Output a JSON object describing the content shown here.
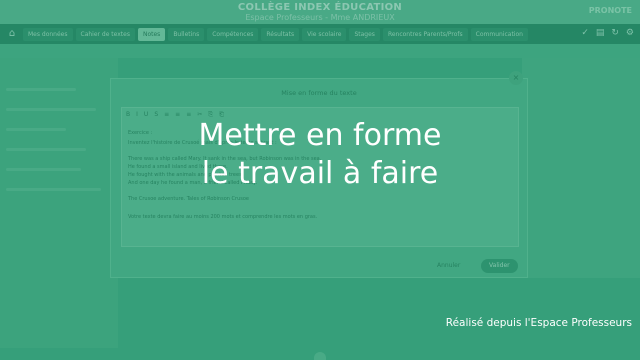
{
  "header": {
    "school_name": "COLLÈGE INDEX ÉDUCATION",
    "subtitle": "Espace Professeurs - Mme ANDRIEUX",
    "brand": "PRONOTE"
  },
  "nav": {
    "home_icon": "home-icon",
    "items": [
      {
        "label": "Mes données"
      },
      {
        "label": "Cahier de textes"
      },
      {
        "label": "Notes",
        "active": true
      },
      {
        "label": "Bulletins"
      },
      {
        "label": "Compétences"
      },
      {
        "label": "Résultats"
      },
      {
        "label": "Vie scolaire"
      },
      {
        "label": "Stages"
      },
      {
        "label": "Rencontres Parents/Profs"
      },
      {
        "label": "Communication"
      }
    ]
  },
  "dialog": {
    "title": "Mise en forme du texte",
    "toolbar": [
      "B",
      "I",
      "U",
      "S",
      "≡",
      "≡",
      "≡",
      "✂",
      "⎘",
      "⎗"
    ],
    "lines": [
      "Exercice :",
      "Inventez l'histoire de Crusoé mais d'après le texte suivant :",
      "There was a ship called Mary. It sank in the sea, but Robinson was in the sea.",
      "He found a small island and lived there.",
      "He fought with the animals and planted trees.",
      "And one day he found a man, a friend called Friday.",
      "The Crusoe adventure. Tales of Robinson Crusoe",
      "Votre texte devra faire au moins 200 mots et comprendre les mots en gras."
    ],
    "cancel_label": "Annuler",
    "validate_label": "Valider"
  },
  "overlay": {
    "headline_line1": "Mettre en forme",
    "headline_line2": "le travail à faire",
    "footer": "Réalisé depuis l'Espace Professeurs"
  }
}
